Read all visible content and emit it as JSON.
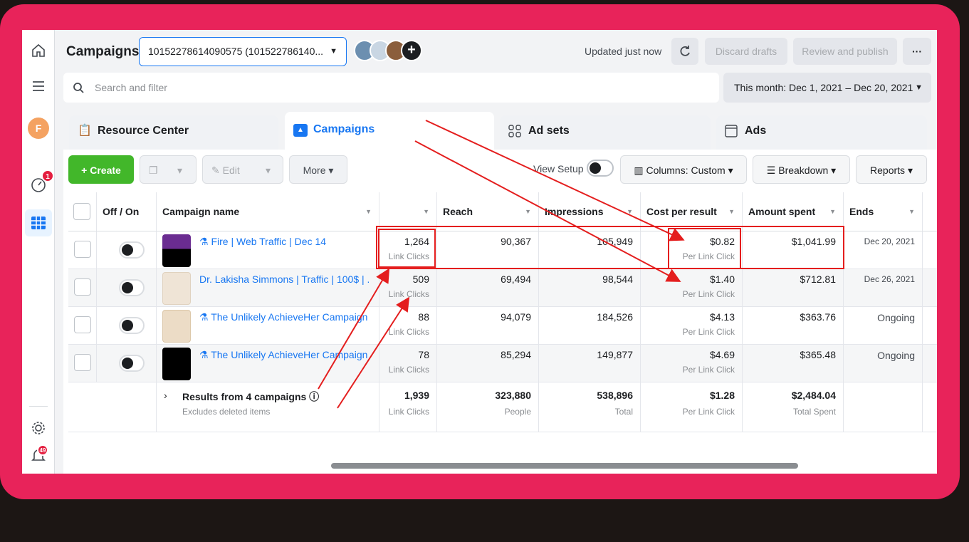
{
  "sidebar": {
    "avatar_letter": "F",
    "notif_badge": "1",
    "alerts_badge": "49"
  },
  "header": {
    "title": "Campaigns",
    "account_select": "10152278614090575 (101522786140...",
    "updated": "Updated just now",
    "discard_label": "Discard drafts",
    "review_label": "Review and publish",
    "more_label": "···"
  },
  "search": {
    "placeholder": "Search and filter",
    "date_range": "This month: Dec 1, 2021 – Dec 20, 2021"
  },
  "tabs": [
    {
      "label": "Resource Center"
    },
    {
      "label": "Campaigns"
    },
    {
      "label": "Ad sets"
    },
    {
      "label": "Ads"
    }
  ],
  "toolbar": {
    "create_label": "Create",
    "edit_label": "Edit",
    "more_label": "More",
    "view_setup_label": "View Setup",
    "columns_label": "Columns: Custom",
    "breakdown_label": "Breakdown",
    "reports_label": "Reports"
  },
  "table": {
    "headers": {
      "off_on": "Off / On",
      "campaign_name": "Campaign name",
      "reach": "Reach",
      "impressions": "Impressions",
      "cost_per_result": "Cost per result",
      "amount_spent": "Amount spent",
      "ends": "Ends"
    },
    "rows": [
      {
        "name": "Fire | Web Traffic | Dec 14",
        "results": "1,264",
        "results_sub": "Link Clicks",
        "reach": "90,367",
        "impressions": "105,949",
        "cost": "$0.82",
        "cost_sub": "Per Link Click",
        "spent": "$1,041.99",
        "ends": "Dec 20, 2021"
      },
      {
        "name": "Dr. Lakisha Simmons | Traffic | 100$ | ...",
        "results": "509",
        "results_sub": "Link Clicks",
        "reach": "69,494",
        "impressions": "98,544",
        "cost": "$1.40",
        "cost_sub": "Per Link Click",
        "spent": "$712.81",
        "ends": "Dec 26, 2021"
      },
      {
        "name": "The Unlikely AchieveHer Campaign",
        "results": "88",
        "results_sub": "Link Clicks",
        "reach": "94,079",
        "impressions": "184,526",
        "cost": "$4.13",
        "cost_sub": "Per Link Click",
        "spent": "$363.76",
        "ends": "Ongoing"
      },
      {
        "name": "The Unlikely AchieveHer Campaign",
        "results": "78",
        "results_sub": "Link Clicks",
        "reach": "85,294",
        "impressions": "149,877",
        "cost": "$4.69",
        "cost_sub": "Per Link Click",
        "spent": "$365.48",
        "ends": "Ongoing"
      }
    ],
    "summary": {
      "title": "Results from 4 campaigns",
      "subtitle": "Excludes deleted items",
      "results": "1,939",
      "results_sub": "Link Clicks",
      "reach": "323,880",
      "reach_sub": "People",
      "impressions": "538,896",
      "impressions_sub": "Total",
      "cost": "$1.28",
      "cost_sub": "Per Link Click",
      "spent": "$2,484.04",
      "spent_sub": "Total Spent"
    }
  },
  "colors": {
    "frame": "#e8235a",
    "accent": "#1877f2",
    "create": "#42b72a",
    "annotation": "#e41e1e"
  }
}
